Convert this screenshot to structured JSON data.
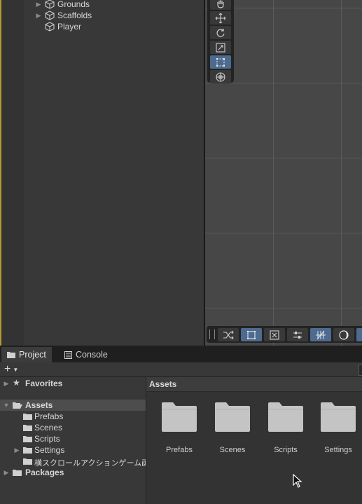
{
  "hierarchy": {
    "items": [
      {
        "label": "Grounds",
        "expandable": true
      },
      {
        "label": "Scaffolds",
        "expandable": true
      },
      {
        "label": "Player",
        "expandable": false
      }
    ]
  },
  "scene": {
    "tools": [
      "hand-tool",
      "move-tool",
      "rotate-tool",
      "scale-tool",
      "rect-tool",
      "transform-tool"
    ],
    "active_tool": "rect-tool",
    "bottom_tools": [
      "snap-toggle",
      "rect-snap",
      "grid-snap",
      "snap-settings",
      "grid-toggle",
      "shading-mode"
    ]
  },
  "tabs": [
    {
      "label": "Project",
      "icon": "folder-icon",
      "active": true
    },
    {
      "label": "Console",
      "icon": "console-icon",
      "active": false
    }
  ],
  "toolbar": {
    "add_label": "+"
  },
  "tree": {
    "favorites": "Favorites",
    "assets": "Assets",
    "asset_children": [
      "Prefabs",
      "Scenes",
      "Scripts",
      "Settings",
      "横スクロールアクションゲーム画像素"
    ],
    "packages": "Packages"
  },
  "assets_view": {
    "title": "Assets",
    "items": [
      "Prefabs",
      "Scenes",
      "Scripts",
      "Settings"
    ]
  },
  "colors": {
    "accent": "#4d6a8f",
    "edge": "#b89a2c",
    "folder": "#c4c4c4"
  }
}
